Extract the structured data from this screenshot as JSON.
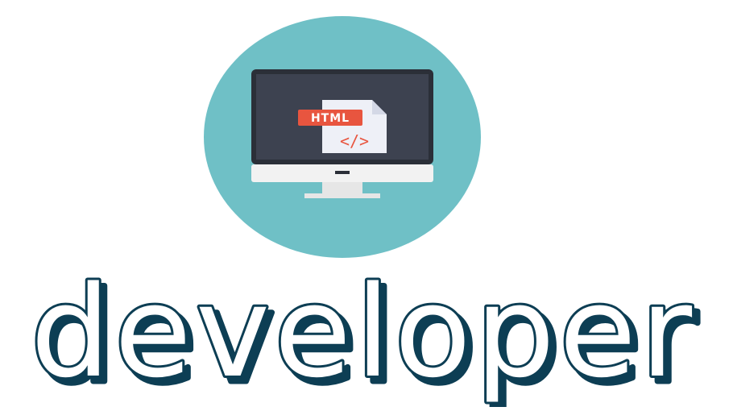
{
  "logo": {
    "badge_label": "HTML",
    "code_glyph": "</>",
    "icon_name": "desktop-monitor-html-file-icon"
  },
  "title": {
    "text": "developer"
  },
  "colors": {
    "circle": "#6fc0c6",
    "screen": "#3d4250",
    "bezel": "#2b2f38",
    "monitor_body": "#f2f2f2",
    "stand": "#e6e6e6",
    "badge": "#e8553f",
    "file": "#eef0f7",
    "file_fold": "#d4d8e6",
    "code": "#e8553f",
    "word_fill": "#ffffff",
    "word_stroke": "#0d3e54",
    "word_shadow": "#0d3e54"
  }
}
